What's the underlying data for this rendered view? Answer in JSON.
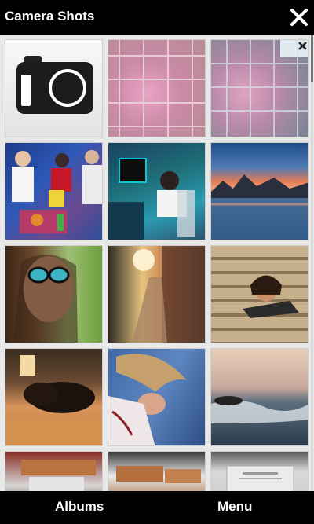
{
  "app": {
    "title": "Camera Shots"
  },
  "softkeys": {
    "left": "Albums",
    "right": "Menu"
  },
  "grid": {
    "thumbnails": [
      {
        "name": "camera-icon-thumbnail"
      },
      {
        "name": "pink-tiles-photo"
      },
      {
        "name": "pink-tiles-window-photo"
      },
      {
        "name": "people-party-photo"
      },
      {
        "name": "computer-desk-photo"
      },
      {
        "name": "lake-mountain-sunset-photo"
      },
      {
        "name": "woman-sunglasses-photo"
      },
      {
        "name": "sunset-street-photo"
      },
      {
        "name": "woman-on-steps-photo"
      },
      {
        "name": "dog-on-table-photo"
      },
      {
        "name": "hair-flip-photo"
      },
      {
        "name": "ocean-wave-photo"
      },
      {
        "name": "food-photo-1"
      },
      {
        "name": "food-photo-2"
      },
      {
        "name": "screen-photo"
      }
    ]
  }
}
